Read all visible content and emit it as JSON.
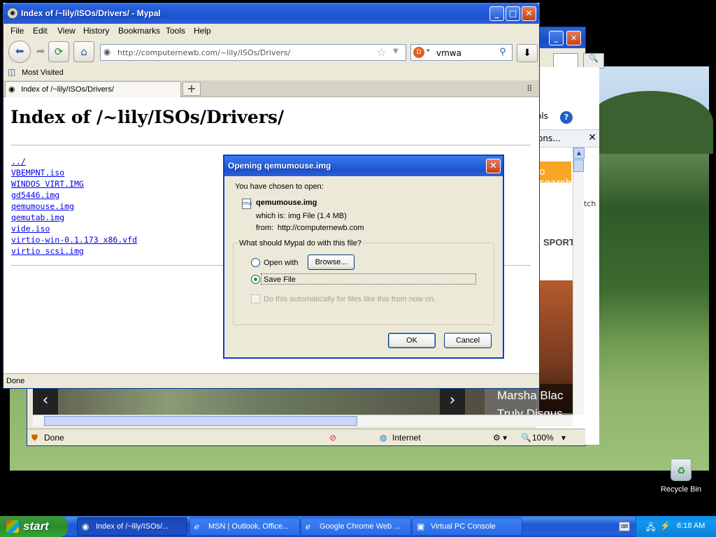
{
  "colors": {
    "titlebar": "#2860dd",
    "link": "#0000ee",
    "taskbar": "#245edb",
    "start": "#2b8a2b"
  },
  "desktop": {
    "recycle_bin_label": "Recycle Bin"
  },
  "msn_window": {
    "tools_label": "ols",
    "tab_label": "ons...",
    "search_promo": "o search",
    "watch_label": "tch",
    "sport_label": "SPORT",
    "headline": "Marsha Blac Truly Disgus",
    "status_done": "Done",
    "status_zone": "Internet",
    "status_zoom": "100%"
  },
  "browser": {
    "title": "Index of /~lily/ISOs/Drivers/ - Mypal",
    "menu": [
      "File",
      "Edit",
      "View",
      "History",
      "Bookmarks",
      "Tools",
      "Help"
    ],
    "url": "http://computernewb.com/~lily/ISOs/Drivers/",
    "search_value": "vmwa",
    "bookmarks_label": "Most Visited",
    "tab_title": "Index of /~lily/ISOs/Drivers/",
    "page_heading": "Index of /~lily/ISOs/Drivers/",
    "files": [
      "../",
      "VBEMPNT.iso",
      "WINDOS VIRT.IMG",
      "gd5446.img",
      "qemumouse.img",
      "qemutab.img",
      "vide.iso",
      "virtio-win-0.1.173 x86.vfd",
      "virtio scsi.img"
    ],
    "status": "Done"
  },
  "dialog": {
    "title": "Opening qemumouse.img",
    "chosen_label": "You have chosen to open:",
    "filename": "qemumouse.img",
    "which_is_label": "which is:",
    "which_is_value": "img File (1.4 MB)",
    "from_label": "from:",
    "from_value": "http://computernewb.com",
    "question": "What should Mypal do with this file?",
    "open_with_label": "Open with",
    "browse_label": "Browse...",
    "save_file_label": "Save File",
    "auto_label": "Do this automatically for files like this from now on.",
    "ok_label": "OK",
    "cancel_label": "Cancel",
    "selected_option": "Save File"
  },
  "taskbar": {
    "start_label": "start",
    "items": [
      {
        "label": "Index of /~lily/ISOs/...",
        "icon": "mypal-icon"
      },
      {
        "label": "MSN | Outlook, Office...",
        "icon": "ie-icon"
      },
      {
        "label": "Google Chrome Web ...",
        "icon": "ie-icon"
      },
      {
        "label": "Virtual PC Console",
        "icon": "vpc-icon"
      }
    ],
    "clock": "6:18 AM"
  }
}
